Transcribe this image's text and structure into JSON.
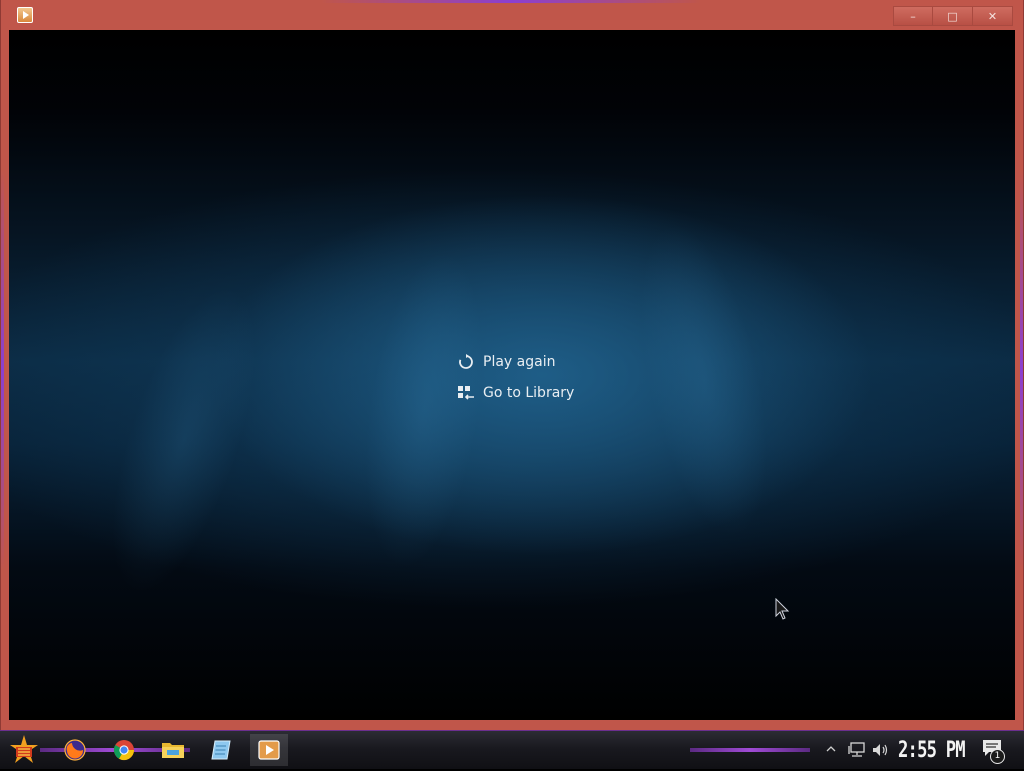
{
  "window": {
    "title_icon": "media-player-icon",
    "controls": {
      "minimize": "–",
      "maximize": "□",
      "close": "✕"
    }
  },
  "menu": {
    "items": [
      {
        "label": "Play again",
        "icon": "replay-icon"
      },
      {
        "label": "Go to Library",
        "icon": "library-icon"
      }
    ]
  },
  "taskbar": {
    "start_icon": "start-icon",
    "apps": [
      {
        "name": "firefox",
        "icon": "firefox-icon"
      },
      {
        "name": "chrome",
        "icon": "chrome-icon"
      },
      {
        "name": "file-explorer",
        "icon": "folder-icon"
      },
      {
        "name": "notepad",
        "icon": "notepad-icon"
      },
      {
        "name": "media-player",
        "icon": "media-player-icon",
        "active": true
      }
    ],
    "tray": {
      "icons": [
        "chevron-up-icon",
        "network-icon",
        "volume-icon"
      ],
      "clock": "2:55 PM",
      "notification_count": "1"
    }
  },
  "colors": {
    "window_frame": "#c0564a",
    "accent_purple": "#8b3fd1",
    "menu_text": "#e9eef2"
  }
}
